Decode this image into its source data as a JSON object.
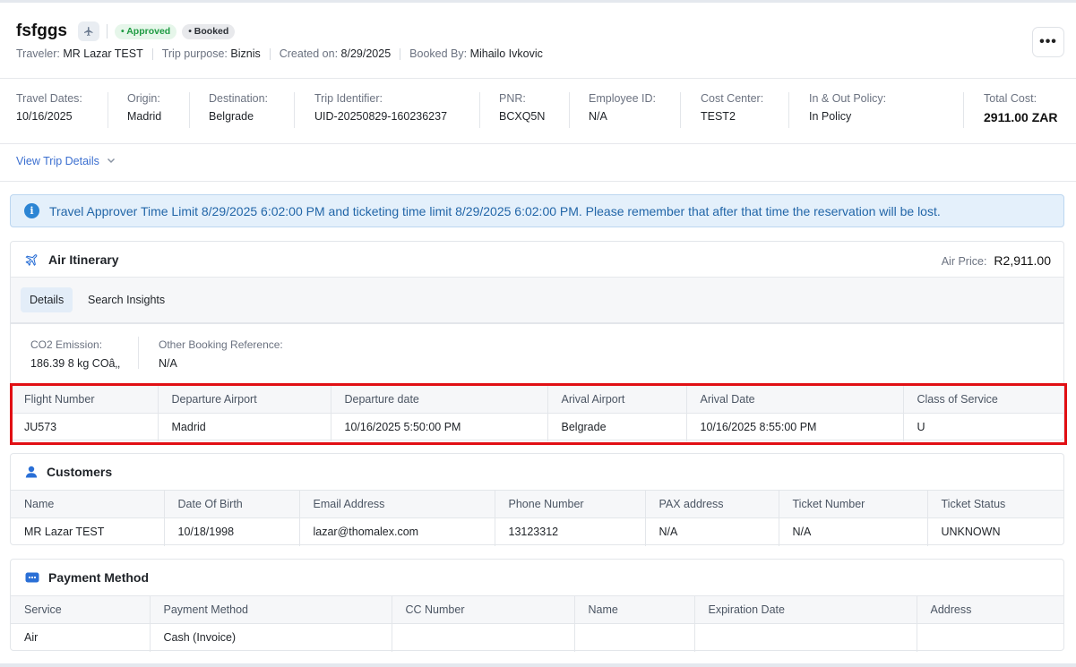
{
  "header": {
    "title": "fsfggs",
    "badges": {
      "approved": "• Approved",
      "booked": "• Booked"
    },
    "meta": [
      {
        "key": "Traveler:",
        "value": "MR Lazar TEST"
      },
      {
        "key": "Trip purpose:",
        "value": "Biznis"
      },
      {
        "key": "Created on:",
        "value": "8/29/2025"
      },
      {
        "key": "Booked By:",
        "value": "Mihailo Ivkovic"
      }
    ],
    "more_label": "•••"
  },
  "info": [
    {
      "label": "Travel Dates:",
      "value": "10/16/2025"
    },
    {
      "label": "Origin:",
      "value": "Madrid"
    },
    {
      "label": "Destination:",
      "value": "Belgrade"
    },
    {
      "label": "Trip Identifier:",
      "value": "UID-20250829-160236237"
    },
    {
      "label": "PNR:",
      "value": "BCXQ5N"
    },
    {
      "label": "Employee ID:",
      "value": "N/A"
    },
    {
      "label": "Cost Center:",
      "value": "TEST2"
    },
    {
      "label": "In & Out Policy:",
      "value": "In Policy"
    },
    {
      "label": "Total Cost:",
      "value": "2911.00 ZAR"
    }
  ],
  "view_details": "View Trip Details",
  "alert": "Travel Approver Time Limit 8/29/2025 6:02:00 PM and ticketing time limit 8/29/2025 6:02:00 PM. Please remember that after that time the reservation will be lost.",
  "air": {
    "title": "Air Itinerary",
    "price_label": "Air Price:",
    "price_value": "R2,911.00",
    "tabs": [
      "Details",
      "Search Insights"
    ],
    "co2_label": "CO2 Emission:",
    "co2_value": "186.39 8 kg COâ‚‚",
    "ref_label": "Other Booking Reference:",
    "ref_value": "N/A",
    "columns": [
      "Flight Number",
      "Departure Airport",
      "Departure date",
      "Arival Airport",
      "Arival Date",
      "Class of Service"
    ],
    "rows": [
      [
        "JU573",
        "Madrid",
        "10/16/2025 5:50:00 PM",
        "Belgrade",
        "10/16/2025 8:55:00 PM",
        "U"
      ]
    ]
  },
  "customers": {
    "title": "Customers",
    "columns": [
      "Name",
      "Date Of Birth",
      "Email Address",
      "Phone Number",
      "PAX address",
      "Ticket Number",
      "Ticket Status"
    ],
    "rows": [
      [
        "MR Lazar TEST",
        "10/18/1998",
        "lazar@thomalex.com",
        "13123312",
        "N/A",
        "N/A",
        "UNKNOWN"
      ]
    ]
  },
  "payment": {
    "title": "Payment Method",
    "columns": [
      "Service",
      "Payment Method",
      "CC Number",
      "Name",
      "Expiration Date",
      "Address"
    ],
    "rows": [
      [
        "Air",
        "Cash (Invoice)",
        "",
        "",
        "",
        ""
      ]
    ]
  },
  "colors": {
    "accent": "#3b6fd0",
    "approved": "#1e9b42",
    "alert_bg": "#e4f0fb",
    "highlight": "#e10f14"
  }
}
